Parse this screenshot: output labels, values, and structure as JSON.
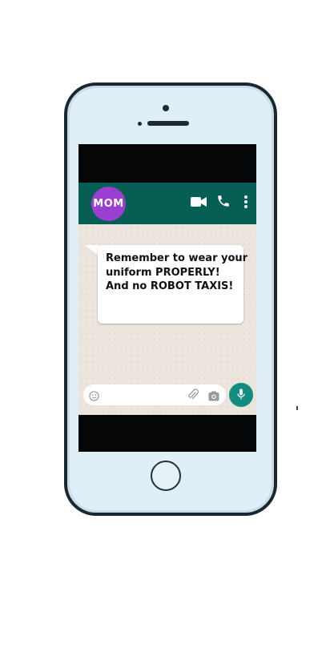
{
  "contact": {
    "avatar_text": "MOM"
  },
  "message": {
    "lines": [
      "Remember to wear your",
      "uniform PROPERLY!",
      "And no ROBOT TAXIS!"
    ]
  },
  "input": {
    "placeholder": ""
  },
  "icons": {
    "video": "video-call-icon",
    "call": "phone-call-icon",
    "menu": "more-vert-icon",
    "emoji": "emoji-icon",
    "attach": "paperclip-icon",
    "camera": "camera-icon",
    "mic": "microphone-icon"
  },
  "colors": {
    "header": "#075e54",
    "avatar": "#9b3fd0",
    "mic_button": "#128c7e",
    "chat_background": "#ece5dd"
  }
}
